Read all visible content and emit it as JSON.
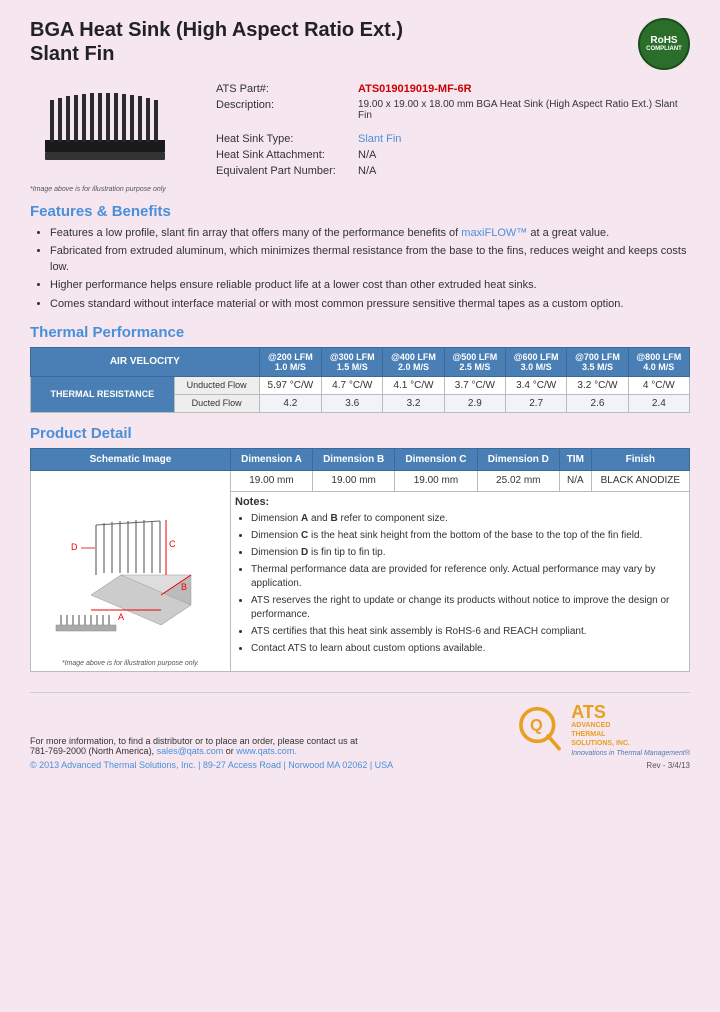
{
  "page": {
    "title_line1": "BGA Heat Sink (High Aspect Ratio Ext.)",
    "title_line2": "Slant Fin",
    "rohs": {
      "line1": "RoHS",
      "line2": "COMPLIANT"
    }
  },
  "specs": {
    "part_label": "ATS Part#:",
    "part_value": "ATS019019019-MF-6R",
    "desc_label": "Description:",
    "desc_value": "19.00 x 19.00 x 18.00 mm BGA Heat Sink (High Aspect Ratio Ext.) Slant Fin",
    "type_label": "Heat Sink Type:",
    "type_value": "Slant Fin",
    "attachment_label": "Heat Sink Attachment:",
    "attachment_value": "N/A",
    "equiv_label": "Equivalent Part Number:",
    "equiv_value": "N/A"
  },
  "image_caption": "*Image above is for illustration purpose only",
  "features": {
    "section_title": "Features & Benefits",
    "items": [
      "Features a low profile, slant fin array that offers many of the performance benefits of maxiFLOW™ at a great value.",
      "Fabricated from extruded aluminum, which minimizes thermal resistance from the base to the fins, reduces weight and keeps costs low.",
      "Higher performance helps ensure reliable product life at a lower cost than other extruded heat sinks.",
      "Comes standard without interface material or with most common pressure sensitive thermal tapes as a custom option."
    ],
    "highlight_text": "maxiFLOW™"
  },
  "thermal": {
    "section_title": "Thermal Performance",
    "air_velocity_label": "AIR VELOCITY",
    "columns": [
      {
        "lfm": "@200 LFM",
        "ms": "1.0 M/S"
      },
      {
        "lfm": "@300 LFM",
        "ms": "1.5 M/S"
      },
      {
        "lfm": "@400 LFM",
        "ms": "2.0 M/S"
      },
      {
        "lfm": "@500 LFM",
        "ms": "2.5 M/S"
      },
      {
        "lfm": "@600 LFM",
        "ms": "3.0 M/S"
      },
      {
        "lfm": "@700 LFM",
        "ms": "3.5 M/S"
      },
      {
        "lfm": "@800 LFM",
        "ms": "4.0 M/S"
      }
    ],
    "row_header": "THERMAL RESISTANCE",
    "rows": [
      {
        "label": "Unducted Flow",
        "values": [
          "5.97 °C/W",
          "4.7 °C/W",
          "4.1 °C/W",
          "3.7 °C/W",
          "3.4 °C/W",
          "3.2 °C/W",
          "4 °C/W"
        ]
      },
      {
        "label": "Ducted Flow",
        "values": [
          "4.2",
          "3.6",
          "3.2",
          "2.9",
          "2.7",
          "2.6",
          "2.4"
        ]
      }
    ]
  },
  "product_detail": {
    "section_title": "Product Detail",
    "headers": [
      "Schematic Image",
      "Dimension A",
      "Dimension B",
      "Dimension C",
      "Dimension D",
      "TIM",
      "Finish"
    ],
    "dim_values": [
      "19.00 mm",
      "19.00 mm",
      "19.00 mm",
      "25.02 mm",
      "N/A",
      "BLACK ANODIZE"
    ],
    "schematic_caption": "*Image above is for illustration purpose only.",
    "notes_title": "Notes:",
    "notes": [
      {
        "text": "Dimension A and B refer to component size.",
        "bolds": [
          "A",
          "B"
        ]
      },
      {
        "text": "Dimension C is the heat sink height from the bottom of the base to the top of the fin field.",
        "bolds": [
          "C"
        ]
      },
      {
        "text": "Dimension D is fin tip to fin tip.",
        "bolds": [
          "D"
        ]
      },
      {
        "text": "Thermal performance data are provided for reference only. Actual performance may vary by application.",
        "bolds": []
      },
      {
        "text": "ATS reserves the right to update or change its products without notice to improve the design or performance.",
        "bolds": []
      },
      {
        "text": "ATS certifies that this heat sink assembly is RoHS-6 and REACH compliant.",
        "bolds": []
      },
      {
        "text": "Contact ATS to learn about custom options available.",
        "bolds": []
      }
    ]
  },
  "footer": {
    "contact_text": "For more information, to find a distributor or to place an order, please contact us at",
    "phone": "781-769-2000 (North America),",
    "email": "sales@qats.com",
    "or_text": "or",
    "website": "www.qats.com.",
    "copyright": "© 2013 Advanced Thermal Solutions, Inc.  |  89-27 Access Road  |  Norwood MA  02062  |  USA",
    "ats_q": "Q",
    "ats_name": "ATS",
    "ats_full1": "ADVANCED",
    "ats_full2": "THERMAL",
    "ats_full3": "SOLUTIONS, INC.",
    "ats_tagline": "Innovations in Thermal Management®",
    "page_num": "Rev - 3/4/13"
  }
}
